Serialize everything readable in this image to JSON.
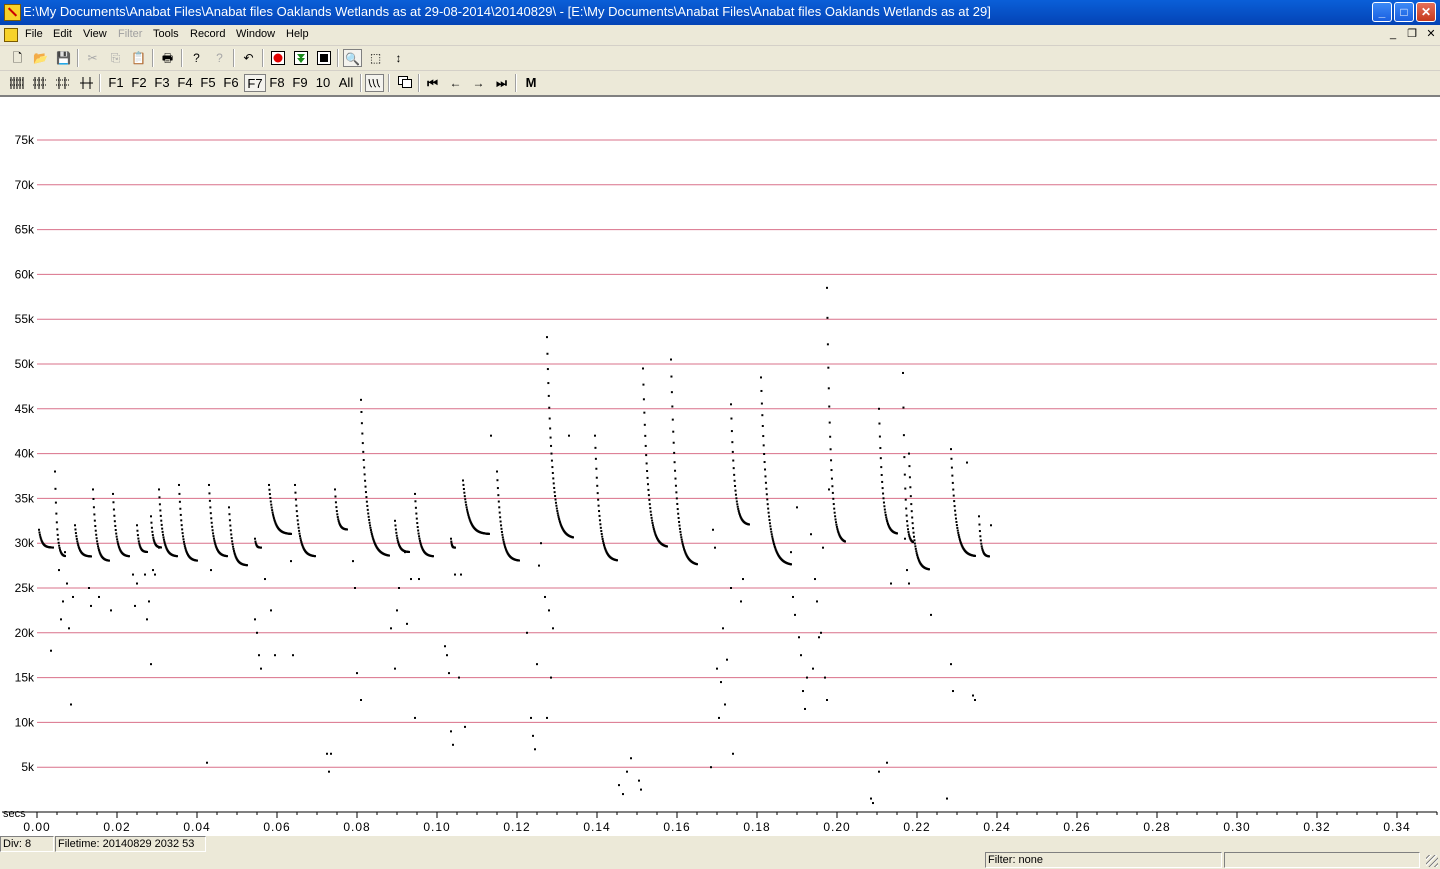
{
  "window": {
    "title": "E:\\My Documents\\Anabat Files\\Anabat files Oaklands Wetlands as at 29-08-2014\\20140829\\ - [E:\\My Documents\\Anabat Files\\Anabat files Oaklands Wetlands as at 29]",
    "minimize_glyph": "_",
    "maximize_glyph": "□",
    "close_glyph": "✕"
  },
  "menu": {
    "file": "File",
    "edit": "Edit",
    "view": "View",
    "filter": "Filter",
    "tools": "Tools",
    "record": "Record",
    "window": "Window",
    "help": "Help",
    "mdi_minimize": "_",
    "mdi_restore": "❐",
    "mdi_close": "✕"
  },
  "toolbar1": {
    "new": "🗋",
    "open": "📂",
    "save": "💾",
    "cut": "✂",
    "copy": "⎘",
    "paste": "📋",
    "print": "🖶",
    "help": "?",
    "context_help": "?",
    "undo": "↶",
    "zoom": "🔍",
    "select": "⬚",
    "scroll": "↕"
  },
  "toolbar2": {
    "keys": [
      "F1",
      "F2",
      "F3",
      "F4",
      "F5",
      "F6",
      "F7",
      "F8",
      "F9",
      "10",
      "All"
    ],
    "pressed_key": "F7",
    "first": "⏮",
    "prev": "←",
    "next": "→",
    "last": "⏭",
    "m": "M"
  },
  "colors": {
    "gridline": "#d9708a",
    "dot": "#000000",
    "axis": "#000000"
  },
  "chart_data": {
    "type": "scatter",
    "xlabel": "secs",
    "ylabel": "",
    "xlim": [
      0,
      0.35
    ],
    "ylim": [
      0,
      80
    ],
    "y_unit": "k",
    "x_ticks": [
      0.0,
      0.02,
      0.04,
      0.06,
      0.08,
      0.1,
      0.12,
      0.14,
      0.16,
      0.18,
      0.2,
      0.22,
      0.24,
      0.26,
      0.28,
      0.3,
      0.32,
      0.34
    ],
    "x_tick_labels": [
      "0.00",
      "0.02",
      "0.04",
      "0.06",
      "0.08",
      "0.10",
      "0.12",
      "0.14",
      "0.16",
      "0.18",
      "0.20",
      "0.22",
      "0.24",
      "0.26",
      "0.28",
      "0.30",
      "0.32",
      "0.34"
    ],
    "y_ticks": [
      5,
      10,
      15,
      20,
      25,
      30,
      35,
      40,
      45,
      50,
      55,
      60,
      65,
      70,
      75
    ],
    "y_tick_labels": [
      "5k",
      "10k",
      "15k",
      "20k",
      "25k",
      "30k",
      "35k",
      "40k",
      "45k",
      "50k",
      "55k",
      "60k",
      "65k",
      "70k",
      "75k"
    ],
    "grid": "horizontal",
    "pulses": [
      {
        "t": 0.0005,
        "f_hi": 31.5,
        "f_lo": 29.5,
        "dur": 0.0035
      },
      {
        "t": 0.0045,
        "f_hi": 38.0,
        "f_lo": 28.5,
        "dur": 0.0025
      },
      {
        "t": 0.0095,
        "f_hi": 32.0,
        "f_lo": 28.5,
        "dur": 0.004
      },
      {
        "t": 0.014,
        "f_hi": 36.0,
        "f_lo": 28.0,
        "dur": 0.004
      },
      {
        "t": 0.019,
        "f_hi": 35.5,
        "f_lo": 28.5,
        "dur": 0.004
      },
      {
        "t": 0.025,
        "f_hi": 32.0,
        "f_lo": 29.0,
        "dur": 0.0025
      },
      {
        "t": 0.0285,
        "f_hi": 33.0,
        "f_lo": 29.5,
        "dur": 0.0025
      },
      {
        "t": 0.0305,
        "f_hi": 36.0,
        "f_lo": 28.5,
        "dur": 0.0045
      },
      {
        "t": 0.0355,
        "f_hi": 36.5,
        "f_lo": 28.0,
        "dur": 0.0045
      },
      {
        "t": 0.043,
        "f_hi": 36.5,
        "f_lo": 28.5,
        "dur": 0.0045
      },
      {
        "t": 0.048,
        "f_hi": 34.0,
        "f_lo": 27.5,
        "dur": 0.0045
      },
      {
        "t": 0.0545,
        "f_hi": 30.5,
        "f_lo": 29.5,
        "dur": 0.0015
      },
      {
        "t": 0.058,
        "f_hi": 36.5,
        "f_lo": 31.0,
        "dur": 0.0055
      },
      {
        "t": 0.0645,
        "f_hi": 36.5,
        "f_lo": 28.5,
        "dur": 0.005
      },
      {
        "t": 0.0745,
        "f_hi": 36.0,
        "f_lo": 31.5,
        "dur": 0.003
      },
      {
        "t": 0.081,
        "f_hi": 46.0,
        "f_lo": 28.5,
        "dur": 0.007
      },
      {
        "t": 0.0895,
        "f_hi": 32.5,
        "f_lo": 29.0,
        "dur": 0.0035
      },
      {
        "t": 0.0945,
        "f_hi": 35.5,
        "f_lo": 28.5,
        "dur": 0.0045
      },
      {
        "t": 0.1035,
        "f_hi": 30.5,
        "f_lo": 29.5,
        "dur": 0.001
      },
      {
        "t": 0.1065,
        "f_hi": 37.0,
        "f_lo": 31.0,
        "dur": 0.0065
      },
      {
        "t": 0.115,
        "f_hi": 38.0,
        "f_lo": 28.0,
        "dur": 0.0055
      },
      {
        "t": 0.1275,
        "f_hi": 53.0,
        "f_lo": 30.5,
        "dur": 0.0065
      },
      {
        "t": 0.1395,
        "f_hi": 42.0,
        "f_lo": 28.0,
        "dur": 0.0055
      },
      {
        "t": 0.1515,
        "f_hi": 49.5,
        "f_lo": 29.5,
        "dur": 0.006
      },
      {
        "t": 0.1585,
        "f_hi": 50.5,
        "f_lo": 27.5,
        "dur": 0.0065
      },
      {
        "t": 0.1735,
        "f_hi": 45.5,
        "f_lo": 32.0,
        "dur": 0.0045
      },
      {
        "t": 0.181,
        "f_hi": 48.5,
        "f_lo": 27.5,
        "dur": 0.0075
      },
      {
        "t": 0.1975,
        "f_hi": 58.5,
        "f_lo": 30.0,
        "dur": 0.0045
      },
      {
        "t": 0.2105,
        "f_hi": 45.0,
        "f_lo": 31.0,
        "dur": 0.0045
      },
      {
        "t": 0.2165,
        "f_hi": 49.0,
        "f_lo": 30.0,
        "dur": 0.0025
      },
      {
        "t": 0.218,
        "f_hi": 40.0,
        "f_lo": 27.0,
        "dur": 0.005
      },
      {
        "t": 0.2285,
        "f_hi": 40.5,
        "f_lo": 28.5,
        "dur": 0.006
      },
      {
        "t": 0.2355,
        "f_hi": 33.0,
        "f_lo": 28.5,
        "dur": 0.0025
      }
    ],
    "scatter_points": [
      [
        0.0035,
        18.0
      ],
      [
        0.0055,
        27.0
      ],
      [
        0.006,
        21.5
      ],
      [
        0.0065,
        23.5
      ],
      [
        0.007,
        29.0
      ],
      [
        0.0075,
        25.5
      ],
      [
        0.008,
        20.5
      ],
      [
        0.0085,
        12.0
      ],
      [
        0.009,
        24.0
      ],
      [
        0.013,
        25.0
      ],
      [
        0.0135,
        23.0
      ],
      [
        0.0155,
        24.0
      ],
      [
        0.0185,
        22.5
      ],
      [
        0.024,
        26.5
      ],
      [
        0.0245,
        23.0
      ],
      [
        0.025,
        25.5
      ],
      [
        0.027,
        26.5
      ],
      [
        0.0275,
        21.5
      ],
      [
        0.028,
        23.5
      ],
      [
        0.0285,
        16.5
      ],
      [
        0.029,
        27.0
      ],
      [
        0.0295,
        26.5
      ],
      [
        0.0305,
        29.5
      ],
      [
        0.0425,
        5.5
      ],
      [
        0.0435,
        27.0
      ],
      [
        0.0545,
        21.5
      ],
      [
        0.055,
        20.0
      ],
      [
        0.0555,
        17.5
      ],
      [
        0.056,
        16.0
      ],
      [
        0.057,
        26.0
      ],
      [
        0.0585,
        22.5
      ],
      [
        0.0595,
        17.5
      ],
      [
        0.0635,
        28.0
      ],
      [
        0.064,
        17.5
      ],
      [
        0.0725,
        6.5
      ],
      [
        0.073,
        4.5
      ],
      [
        0.0735,
        6.5
      ],
      [
        0.079,
        28.0
      ],
      [
        0.0795,
        25.0
      ],
      [
        0.08,
        15.5
      ],
      [
        0.081,
        12.5
      ],
      [
        0.0885,
        20.5
      ],
      [
        0.0895,
        16.0
      ],
      [
        0.09,
        22.5
      ],
      [
        0.0905,
        25.0
      ],
      [
        0.092,
        29.0
      ],
      [
        0.0925,
        21.0
      ],
      [
        0.0935,
        26.0
      ],
      [
        0.0945,
        10.5
      ],
      [
        0.0955,
        26.0
      ],
      [
        0.102,
        18.5
      ],
      [
        0.1025,
        17.5
      ],
      [
        0.103,
        15.5
      ],
      [
        0.1035,
        9.0
      ],
      [
        0.104,
        7.5
      ],
      [
        0.1045,
        26.5
      ],
      [
        0.1055,
        15.0
      ],
      [
        0.106,
        26.5
      ],
      [
        0.107,
        9.5
      ],
      [
        0.1135,
        42.0
      ],
      [
        0.1225,
        20.0
      ],
      [
        0.1235,
        10.5
      ],
      [
        0.124,
        8.5
      ],
      [
        0.1245,
        7.0
      ],
      [
        0.125,
        16.5
      ],
      [
        0.1255,
        27.5
      ],
      [
        0.126,
        30.0
      ],
      [
        0.127,
        24.0
      ],
      [
        0.1275,
        10.5
      ],
      [
        0.128,
        22.5
      ],
      [
        0.1285,
        15.0
      ],
      [
        0.129,
        20.5
      ],
      [
        0.133,
        42.0
      ],
      [
        0.1455,
        3.0
      ],
      [
        0.1465,
        2.0
      ],
      [
        0.1475,
        4.5
      ],
      [
        0.1485,
        6.0
      ],
      [
        0.1505,
        3.5
      ],
      [
        0.151,
        2.5
      ],
      [
        0.1685,
        5.0
      ],
      [
        0.169,
        31.5
      ],
      [
        0.1695,
        29.5
      ],
      [
        0.17,
        16.0
      ],
      [
        0.1705,
        10.5
      ],
      [
        0.171,
        14.5
      ],
      [
        0.1715,
        20.5
      ],
      [
        0.172,
        12.0
      ],
      [
        0.1725,
        17.0
      ],
      [
        0.1735,
        25.0
      ],
      [
        0.174,
        6.5
      ],
      [
        0.176,
        23.5
      ],
      [
        0.1765,
        26.0
      ],
      [
        0.1885,
        29.0
      ],
      [
        0.189,
        24.0
      ],
      [
        0.1895,
        22.0
      ],
      [
        0.19,
        34.0
      ],
      [
        0.1905,
        19.5
      ],
      [
        0.191,
        17.5
      ],
      [
        0.1915,
        13.5
      ],
      [
        0.192,
        11.5
      ],
      [
        0.1925,
        15.0
      ],
      [
        0.1935,
        31.0
      ],
      [
        0.194,
        16.0
      ],
      [
        0.1945,
        26.0
      ],
      [
        0.195,
        23.5
      ],
      [
        0.1955,
        19.5
      ],
      [
        0.196,
        20.0
      ],
      [
        0.1965,
        29.5
      ],
      [
        0.197,
        15.0
      ],
      [
        0.1975,
        12.5
      ],
      [
        0.198,
        36.0
      ],
      [
        0.2085,
        1.5
      ],
      [
        0.209,
        1.0
      ],
      [
        0.2105,
        4.5
      ],
      [
        0.2125,
        5.5
      ],
      [
        0.2135,
        25.5
      ],
      [
        0.217,
        30.5
      ],
      [
        0.2175,
        27.0
      ],
      [
        0.218,
        25.5
      ],
      [
        0.2235,
        22.0
      ],
      [
        0.2275,
        1.5
      ],
      [
        0.2285,
        16.5
      ],
      [
        0.229,
        13.5
      ],
      [
        0.2325,
        39.0
      ],
      [
        0.234,
        13.0
      ],
      [
        0.2345,
        12.5
      ],
      [
        0.2385,
        32.0
      ]
    ]
  },
  "status": {
    "div": "Div: 8",
    "filetime": "Filetime: 20140829 2032 53",
    "filter": "Filter: none"
  }
}
